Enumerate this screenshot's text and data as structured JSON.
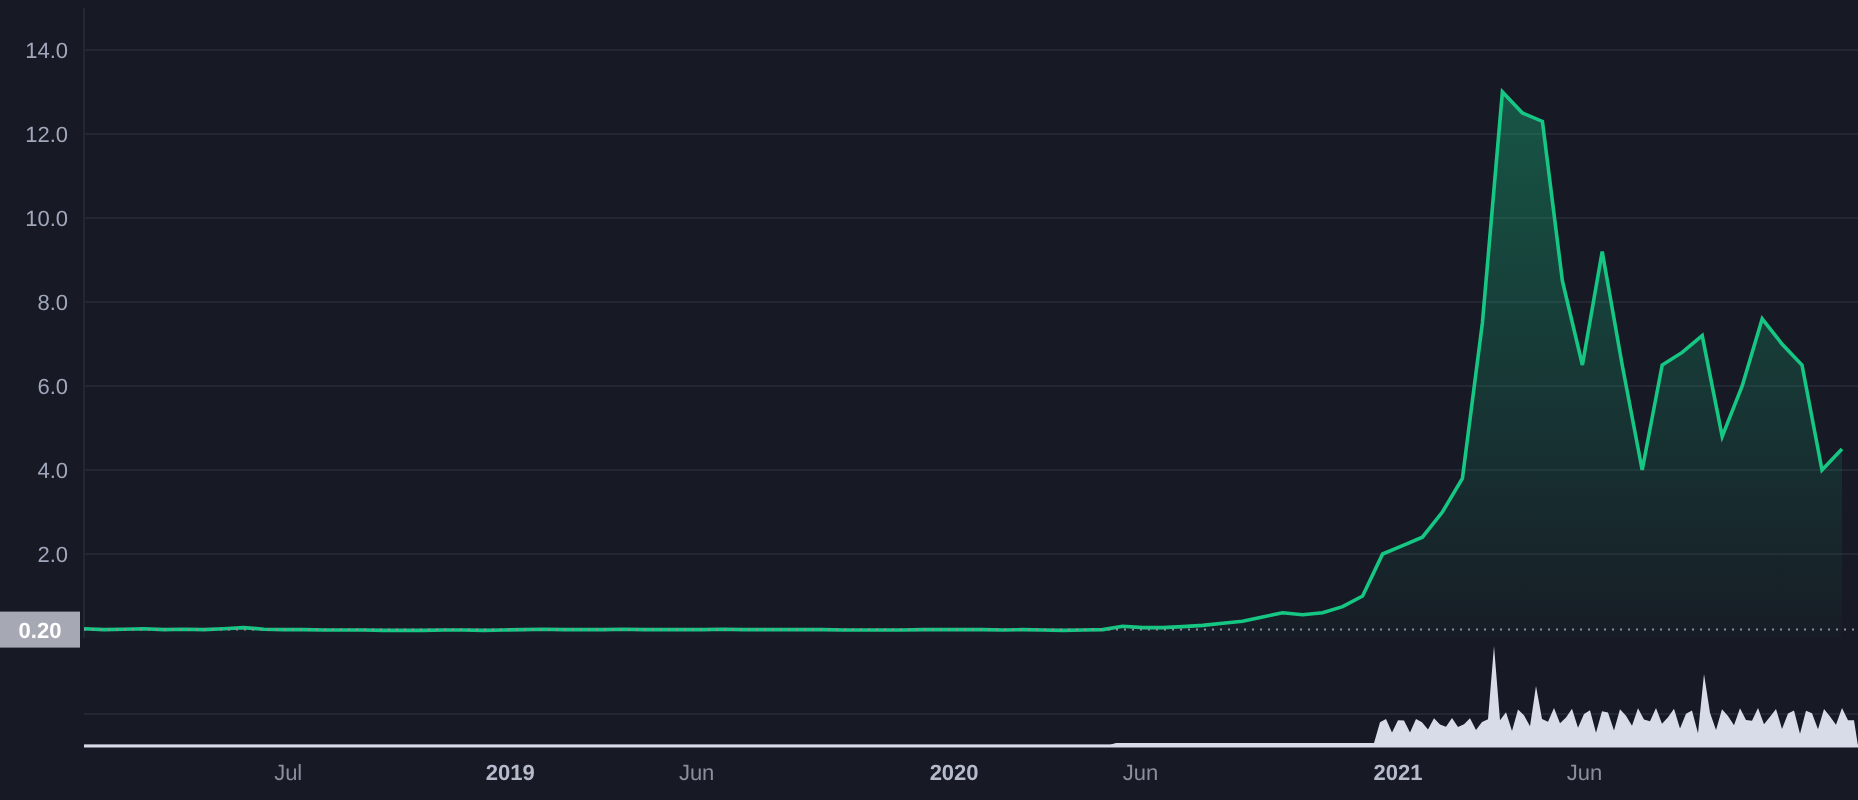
{
  "chart": {
    "chart_data": {
      "type": "area",
      "grid": true,
      "ref_lines": [
        {
          "axis": "y",
          "value": 0.2,
          "label": "0.20"
        }
      ],
      "xlim": [
        2018.04,
        2022.036
      ],
      "ylim": [
        0,
        15
      ],
      "x": [
        2018.04,
        2018.085,
        2018.13,
        2018.175,
        2018.22,
        2018.265,
        2018.31,
        2018.355,
        2018.4,
        2018.445,
        2018.49,
        2018.535,
        2018.58,
        2018.625,
        2018.67,
        2018.715,
        2018.76,
        2018.805,
        2018.85,
        2018.895,
        2018.94,
        2018.985,
        2019.03,
        2019.075,
        2019.12,
        2019.165,
        2019.21,
        2019.255,
        2019.3,
        2019.345,
        2019.39,
        2019.435,
        2019.48,
        2019.525,
        2019.57,
        2019.615,
        2019.66,
        2019.705,
        2019.75,
        2019.795,
        2019.84,
        2019.885,
        2019.93,
        2019.975,
        2020.02,
        2020.065,
        2020.11,
        2020.155,
        2020.2,
        2020.245,
        2020.29,
        2020.335,
        2020.38,
        2020.425,
        2020.47,
        2020.515,
        2020.56,
        2020.605,
        2020.65,
        2020.695,
        2020.74,
        2020.785,
        2020.83,
        2020.875,
        2020.92,
        2020.965,
        2021.01,
        2021.055,
        2021.1,
        2021.145,
        2021.19,
        2021.235,
        2021.28,
        2021.325,
        2021.37,
        2021.415,
        2021.46,
        2021.505,
        2021.55,
        2021.595,
        2021.64,
        2021.685,
        2021.73,
        2021.775,
        2021.82,
        2021.865,
        2021.91,
        2021.955,
        2022.0
      ],
      "series": [
        {
          "color": "#16c784",
          "values": [
            0.22,
            0.2,
            0.21,
            0.22,
            0.2,
            0.21,
            0.2,
            0.22,
            0.25,
            0.21,
            0.2,
            0.2,
            0.19,
            0.19,
            0.19,
            0.18,
            0.18,
            0.18,
            0.19,
            0.19,
            0.18,
            0.19,
            0.2,
            0.21,
            0.2,
            0.2,
            0.2,
            0.21,
            0.2,
            0.2,
            0.2,
            0.2,
            0.21,
            0.2,
            0.2,
            0.2,
            0.2,
            0.2,
            0.19,
            0.19,
            0.19,
            0.19,
            0.2,
            0.2,
            0.2,
            0.2,
            0.19,
            0.2,
            0.19,
            0.18,
            0.19,
            0.2,
            0.28,
            0.25,
            0.25,
            0.27,
            0.3,
            0.35,
            0.4,
            0.5,
            0.6,
            0.55,
            0.6,
            0.75,
            1.0,
            2.0,
            2.2,
            2.4,
            3.0,
            3.8,
            7.5,
            13.0,
            12.5,
            12.3,
            8.5,
            6.5,
            9.2,
            6.5,
            4.0,
            6.5,
            6.8,
            7.2,
            4.8,
            6.0,
            7.6,
            7.0,
            6.5,
            4.0,
            4.5
          ]
        }
      ],
      "yticks": [
        {
          "value": 2,
          "label": "2.0"
        },
        {
          "value": 4,
          "label": "4.0"
        },
        {
          "value": 6,
          "label": "6.0"
        },
        {
          "value": 8,
          "label": "8.0"
        },
        {
          "value": 10,
          "label": "10.0"
        },
        {
          "value": 12,
          "label": "12.0"
        },
        {
          "value": 14,
          "label": "14.0"
        }
      ],
      "xticks": [
        {
          "value": 2018.5,
          "label": "Jul"
        },
        2019,
        {
          "value": 2019.42,
          "label": "Jun"
        },
        2020,
        {
          "value": 2020.42,
          "label": "Jun"
        },
        2021,
        {
          "value": 2021.42,
          "label": "Jun"
        }
      ]
    }
  }
}
